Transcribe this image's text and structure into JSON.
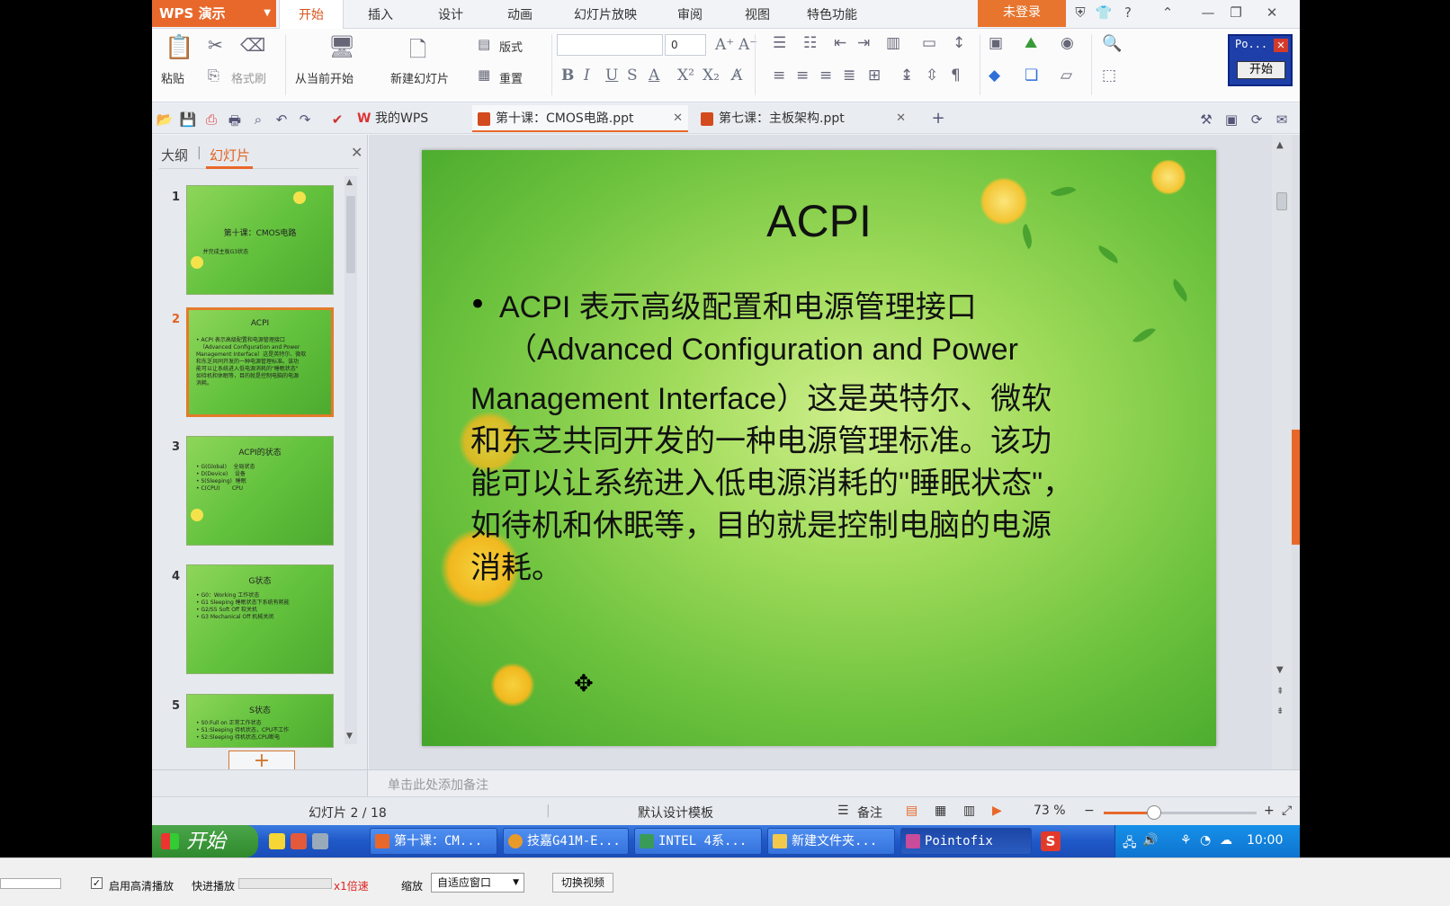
{
  "app": {
    "logo": "WPS 演示",
    "menus": [
      "开始",
      "插入",
      "设计",
      "动画",
      "幻灯片放映",
      "审阅",
      "视图",
      "特色功能"
    ],
    "active_menu": "开始",
    "login": "未登录"
  },
  "ribbon": {
    "paste": "粘贴",
    "format_painter": "格式刷",
    "from_current": "从当前开始",
    "new_slide": "新建幻灯片",
    "layout": "版式",
    "reset": "重置",
    "font_size_value": "0"
  },
  "po_window": {
    "title": "Po...",
    "button": "开始"
  },
  "tabs": {
    "my_wps": "我的WPS",
    "doc1": "第十课：CMOS电路.ppt",
    "doc2": "第七课：主板架构.ppt"
  },
  "left_panel": {
    "tab_outline": "大纲",
    "tab_slides": "幻灯片",
    "thumbnails": [
      {
        "num": "1",
        "title": "第十课：CMOS电路",
        "lines": "    并完成主板G3状态"
      },
      {
        "num": "2",
        "title": "ACPI",
        "lines": "• ACPI 表示高级配置和电源管理接口\n  （Advanced Configuration and Power\nManagement Interface）这是英特尔、微软\n和东芝共同开发的一种电源管理标准。该功\n能可以让系统进入低电源消耗的\"睡眠状态\"\n如待机和休眠等，目的就是控制电脑的电源\n消耗。"
      },
      {
        "num": "3",
        "title": "ACPI的状态",
        "lines": "• G(Global)    全局状态\n• D(Device)    设备\n• S(Sleeping)  睡眠\n• C(CPU)       CPU"
      },
      {
        "num": "4",
        "title": "G状态",
        "lines": "• G0：Working 工作状态\n• G1 Sleeping 睡眠状态下系统有耗能\n• G2/S5 Soft Off 软关机\n• G3 Mechanical Off 机械关闭"
      },
      {
        "num": "5",
        "title": "S状态",
        "lines": "• S0:Full on 正常工作状态\n• S1:Sleeping 待机状态，CPU不工作\n• S2:Sleeping 待机状态,CPU断电"
      }
    ]
  },
  "slide": {
    "title": "ACPI",
    "bullet": "•",
    "line1": "ACPI 表示高级配置和电源管理接口",
    "line2": "（Advanced Configuration and Power",
    "line3": "Management Interface）这是英特尔、微软",
    "line4": "和东芝共同开发的一种电源管理标准。该功",
    "line5": "能可以让系统进入低电源消耗的\"睡眠状态\"，",
    "line6": "如待机和休眠等，目的就是控制电脑的电源",
    "line7": "消耗。"
  },
  "notes_placeholder": "单击此处添加备注",
  "status": {
    "slide_count": "幻灯片 2 / 18",
    "template": "默认设计模板",
    "notes": "备注",
    "zoom": "73 %",
    "zoom_level": 0.33
  },
  "taskbar": {
    "start": "开始",
    "tasks": [
      "第十课：CM...",
      "技嘉G41M-E...",
      "INTEL 4系...",
      "新建文件夹...",
      "Pointofix"
    ],
    "time": "10:00"
  },
  "player": {
    "hd_label": "启用高清播放",
    "fast_forward": "快进播放",
    "speed": "x1倍速",
    "scale_label": "缩放",
    "scale_value": "自适应窗口",
    "switch_video": "切换视频"
  }
}
